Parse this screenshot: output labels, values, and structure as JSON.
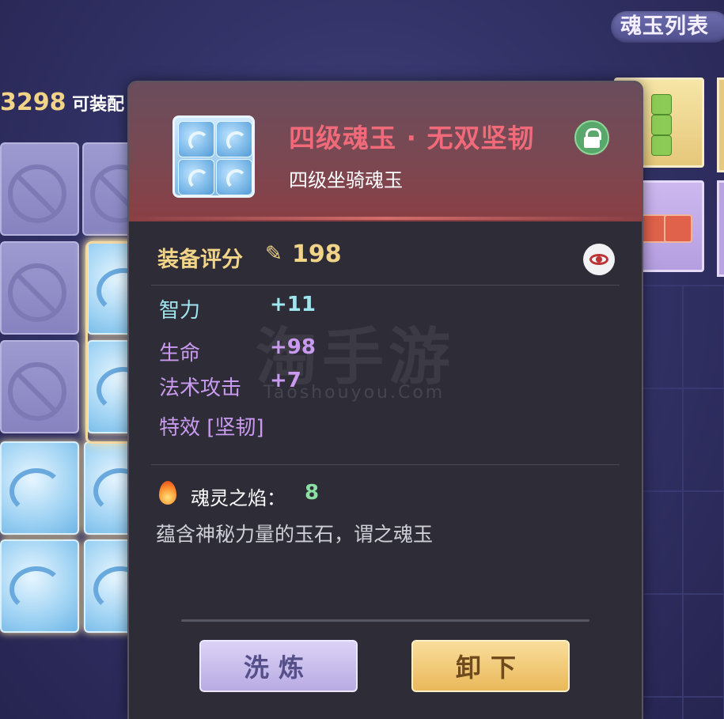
{
  "header": {
    "list_tab_label": "魂玉列表",
    "equip_score_value": "3298",
    "equip_score_suffix": "可装配"
  },
  "tooltip": {
    "item_name": "四级魂玉 · 无双坚韧",
    "item_subtitle": "四级坐骑魂玉",
    "score_label": "装备评分",
    "score_value": "198",
    "stats": [
      {
        "label": "智力",
        "value": "+11"
      },
      {
        "label": "生命",
        "value": "+98"
      },
      {
        "label": "法术攻击",
        "value": "+7"
      },
      {
        "label": "特效 [坚韧]",
        "value": ""
      }
    ],
    "soul_flame_label": "魂灵之焰：",
    "soul_flame_value": "8",
    "description": "蕴含神秘力量的玉石，谓之魂玉",
    "buttons": {
      "wash_label": "洗炼",
      "unload_label": "卸下"
    },
    "watermark": "淘手游",
    "watermark_sub": "Taoshouyou.Com"
  },
  "colors": {
    "name_color": "#f06a7a",
    "score_color": "#f2d489",
    "stat_cyan": "#9fe6f0",
    "stat_purple": "#c99af0",
    "flame_value": "#8ce0a2"
  },
  "icons": [
    "ban-icon",
    "cloud-jade-icon",
    "lock-open-icon",
    "quill-icon",
    "eye-icon",
    "flame-icon"
  ]
}
